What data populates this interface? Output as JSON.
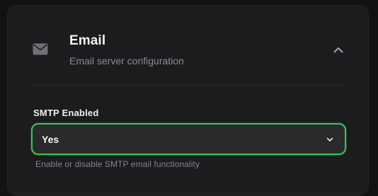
{
  "section": {
    "icon": "mail-icon",
    "title": "Email",
    "subtitle": "Email server configuration",
    "toggle_icon": "chevron-up-icon"
  },
  "field": {
    "label": "SMTP Enabled",
    "selected_value": "Yes",
    "options": [
      "Yes"
    ],
    "help_text": "Enable or disable SMTP email functionality",
    "chevron_icon": "chevron-down-icon"
  },
  "colors": {
    "card_background": "#1c1c1e",
    "focus_border": "#33c45e",
    "muted_text": "#8d8d93"
  }
}
